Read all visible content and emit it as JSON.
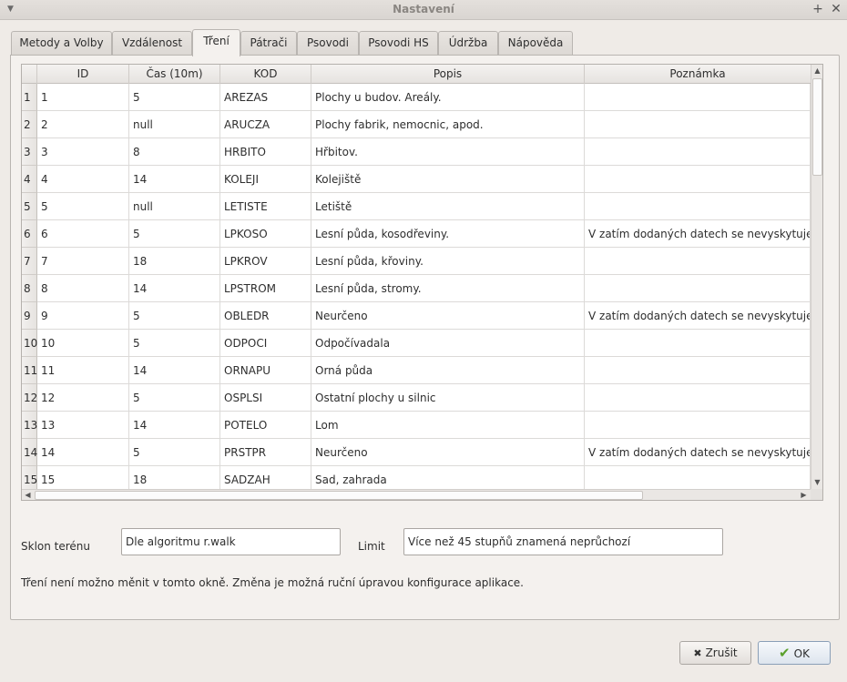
{
  "window": {
    "title": "Nastavení"
  },
  "tabs": [
    "Metody a Volby",
    "Vzdálenost",
    "Tření",
    "Pátrači",
    "Psovodi",
    "Psovodi HS",
    "Údržba",
    "Nápověda"
  ],
  "active_tab": "Tření",
  "table": {
    "columns": [
      "ID",
      "Čas (10m)",
      "KOD",
      "Popis",
      "Poznámka"
    ],
    "rows": [
      {
        "n": "1",
        "id": "1",
        "cas": "5",
        "kod": "AREZAS",
        "popis": "Plochy u budov. Areály.",
        "pozn": ""
      },
      {
        "n": "2",
        "id": "2",
        "cas": "null",
        "kod": "ARUCZA",
        "popis": "Plochy fabrik, nemocnic, apod.",
        "pozn": ""
      },
      {
        "n": "3",
        "id": "3",
        "cas": "8",
        "kod": "HRBITO",
        "popis": "Hřbitov.",
        "pozn": ""
      },
      {
        "n": "4",
        "id": "4",
        "cas": "14",
        "kod": "KOLEJI",
        "popis": "Kolejiště",
        "pozn": ""
      },
      {
        "n": "5",
        "id": "5",
        "cas": "null",
        "kod": "LETISTE",
        "popis": "Letiště",
        "pozn": ""
      },
      {
        "n": "6",
        "id": "6",
        "cas": "5",
        "kod": "LPKOSO",
        "popis": "Lesní půda, kosodřeviny.",
        "pozn": "V zatím dodaných datech se nevyskytuje."
      },
      {
        "n": "7",
        "id": "7",
        "cas": "18",
        "kod": "LPKROV",
        "popis": "Lesní půda, křoviny.",
        "pozn": ""
      },
      {
        "n": "8",
        "id": "8",
        "cas": "14",
        "kod": "LPSTROM",
        "popis": "Lesní půda, stromy.",
        "pozn": ""
      },
      {
        "n": "9",
        "id": "9",
        "cas": "5",
        "kod": "OBLEDR",
        "popis": "Neurčeno",
        "pozn": "V zatím dodaných datech se nevyskytuje."
      },
      {
        "n": "10",
        "id": "10",
        "cas": "5",
        "kod": "ODPOCI",
        "popis": "Odpočívadala",
        "pozn": ""
      },
      {
        "n": "11",
        "id": "11",
        "cas": "14",
        "kod": "ORNAPU",
        "popis": "Orná půda",
        "pozn": ""
      },
      {
        "n": "12",
        "id": "12",
        "cas": "5",
        "kod": "OSPLSI",
        "popis": "Ostatní plochy u silnic",
        "pozn": ""
      },
      {
        "n": "13",
        "id": "13",
        "cas": "14",
        "kod": "POTELO",
        "popis": "Lom",
        "pozn": ""
      },
      {
        "n": "14",
        "id": "14",
        "cas": "5",
        "kod": "PRSTPR",
        "popis": "Neurčeno",
        "pozn": "V zatím dodaných datech se nevyskytuje."
      },
      {
        "n": "15",
        "id": "15",
        "cas": "18",
        "kod": "SADZAH",
        "popis": "Sad, zahrada",
        "pozn": ""
      }
    ]
  },
  "form": {
    "sklon_label": "Sklon terénu",
    "sklon_value": "Dle algoritmu r.walk",
    "limit_label": "Limit",
    "limit_value": "Více než 45 stupňů znamená neprůchozí",
    "note": "Tření není možno měnit v tomto okně. Změna je možná ruční úpravou konfigurace aplikace."
  },
  "buttons": {
    "cancel": "Zrušit",
    "ok": "OK"
  },
  "icons": {
    "window_menu": "chevron-down-icon",
    "maximize": "plus-icon",
    "close": "close-icon",
    "cancel": "x-icon",
    "ok": "check-icon"
  }
}
